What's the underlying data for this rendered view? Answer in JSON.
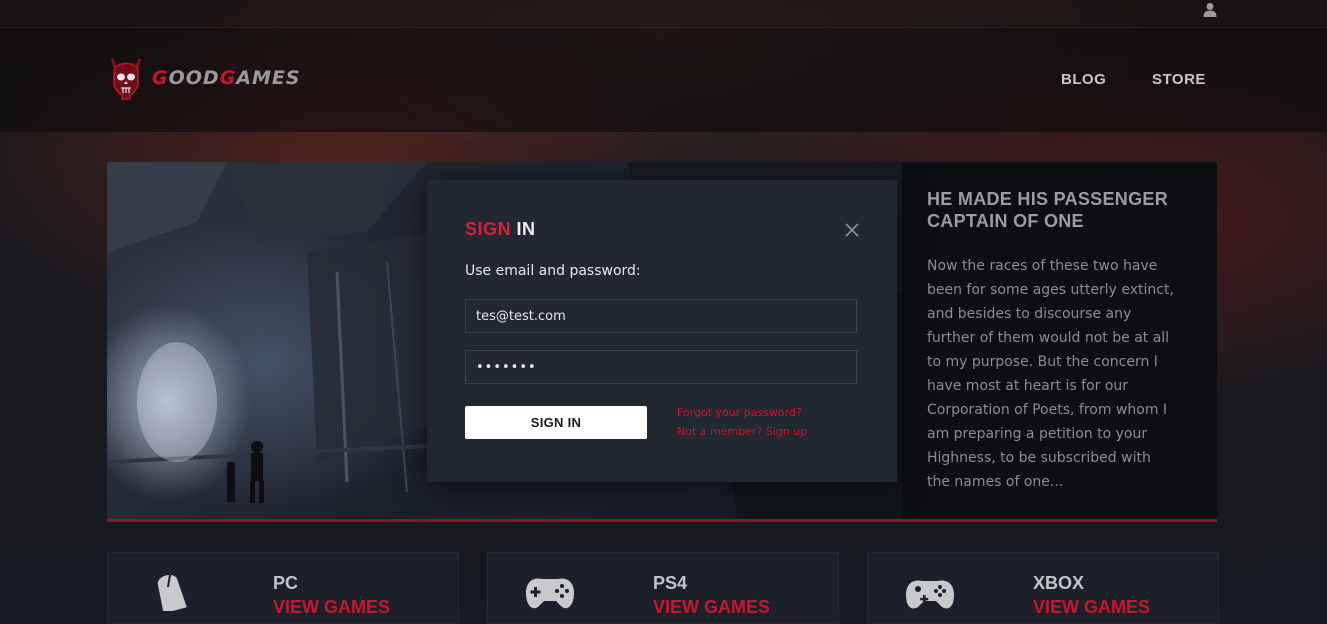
{
  "header": {
    "logo_text_first": "G",
    "logo_text_mid": "OOD",
    "logo_text_g2": "G",
    "logo_text_end": "AMES",
    "nav": [
      "BLOG",
      "STORE"
    ],
    "user_icon": "user-icon"
  },
  "hero": {
    "title": "HE MADE HIS PASSENGER CAPTAIN OF ONE",
    "text": "Now the races of these two have been for some ages utterly extinct, and besides to discourse any further of them would not be at all to my purpose. But the concern I have most at heart is for our Corporation of Poets, from whom I am preparing a petition to your Highness, to be subscribed with the names of one..."
  },
  "modal": {
    "title_accent": "SIGN",
    "title_rest": "IN",
    "subtitle": "Use email and password:",
    "email_value": "tes@test.com",
    "password_value": "•••••••",
    "submit_label": "SIGN IN",
    "forgot_link": "Forgot your password?",
    "signup_link": "Not a member? Sign up",
    "close_icon": "close-icon"
  },
  "platforms": [
    {
      "name": "PC",
      "link": "VIEW GAMES",
      "icon": "mouse-icon"
    },
    {
      "name": "PS4",
      "link": "VIEW GAMES",
      "icon": "gamepad-icon"
    },
    {
      "name": "XBOX",
      "link": "VIEW GAMES",
      "icon": "xbox-controller-icon"
    }
  ],
  "colors": {
    "accent": "#c8152d",
    "modal_bg": "#222830",
    "page_bg": "#181c22"
  }
}
